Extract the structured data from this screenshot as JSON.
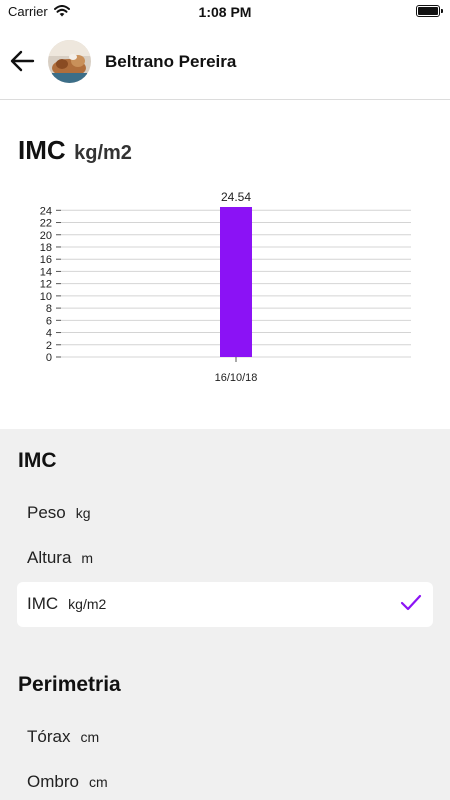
{
  "status_bar": {
    "carrier": "Carrier",
    "time": "1:08 PM"
  },
  "header": {
    "name": "Beltrano Pereira"
  },
  "chart_section": {
    "title": "IMC",
    "unit": "kg/m2"
  },
  "chart_data": {
    "type": "bar",
    "categories": [
      "16/10/18"
    ],
    "values": [
      24.54
    ],
    "value_labels": [
      "24.54"
    ],
    "title": "",
    "xlabel": "",
    "ylabel": "",
    "ylim": [
      0,
      24.54
    ],
    "yticks": [
      0,
      2,
      4,
      6,
      8,
      10,
      12,
      14,
      16,
      18,
      20,
      22,
      24
    ],
    "grid": true,
    "bar_color": "#8B12F5"
  },
  "groups": [
    {
      "title": "IMC",
      "items": [
        {
          "label": "Peso",
          "unit": "kg",
          "selected": false
        },
        {
          "label": "Altura",
          "unit": "m",
          "selected": false
        },
        {
          "label": "IMC",
          "unit": "kg/m2",
          "selected": true
        }
      ]
    },
    {
      "title": "Perimetria",
      "items": [
        {
          "label": "Tórax",
          "unit": "cm",
          "selected": false
        },
        {
          "label": "Ombro",
          "unit": "cm",
          "selected": false
        }
      ]
    }
  ],
  "colors": {
    "accent": "#8B12F5",
    "list_background": "#F0F0F0",
    "selected_row": "#FFFFFF"
  },
  "icons": {
    "back": "arrow-left-icon",
    "selected": "checkmark-icon",
    "avatar": "avatar-photo"
  }
}
